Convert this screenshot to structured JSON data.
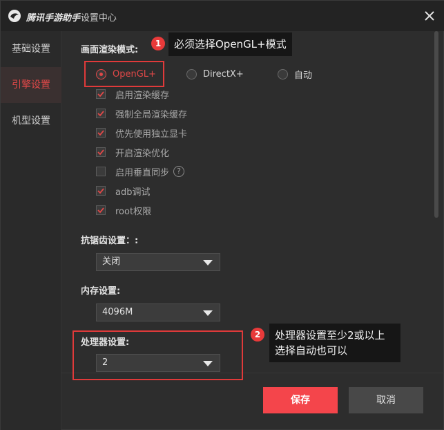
{
  "window": {
    "app_name": "腾讯手游助手",
    "title_suffix": "- 设置中心"
  },
  "sidebar": {
    "items": [
      {
        "label": "基础设置",
        "active": false
      },
      {
        "label": "引擎设置",
        "active": true
      },
      {
        "label": "机型设置",
        "active": false
      }
    ]
  },
  "render_mode": {
    "label": "画面渲染模式:",
    "options": [
      "OpenGL+",
      "DirectX+",
      "自动"
    ],
    "selected": "OpenGL+"
  },
  "checkboxes": [
    {
      "label": "启用渲染缓存",
      "checked": true
    },
    {
      "label": "强制全局渲染缓存",
      "checked": true
    },
    {
      "label": "优先使用独立显卡",
      "checked": true
    },
    {
      "label": "开启渲染优化",
      "checked": true
    },
    {
      "label": "启用垂直同步",
      "checked": false,
      "help": "?"
    },
    {
      "label": "adb调试",
      "checked": true
    },
    {
      "label": "root权限",
      "checked": true
    }
  ],
  "antialias": {
    "label": "抗锯齿设置：:",
    "value": "关闭"
  },
  "memory": {
    "label": "内存设置:",
    "value": "4096M"
  },
  "processor": {
    "label": "处理器设置:",
    "value": "2"
  },
  "footer": {
    "save_label": "保存",
    "cancel_label": "取消"
  },
  "annotations": [
    {
      "number": "1",
      "text": "必须选择OpenGL+模式"
    },
    {
      "number": "2",
      "line1": "处理器设置至少2或以上",
      "line2": "选择自动也可以"
    }
  ],
  "colors": {
    "accent": "#e04848",
    "save_button": "#f4454b",
    "annotation": "#e03a3a"
  }
}
